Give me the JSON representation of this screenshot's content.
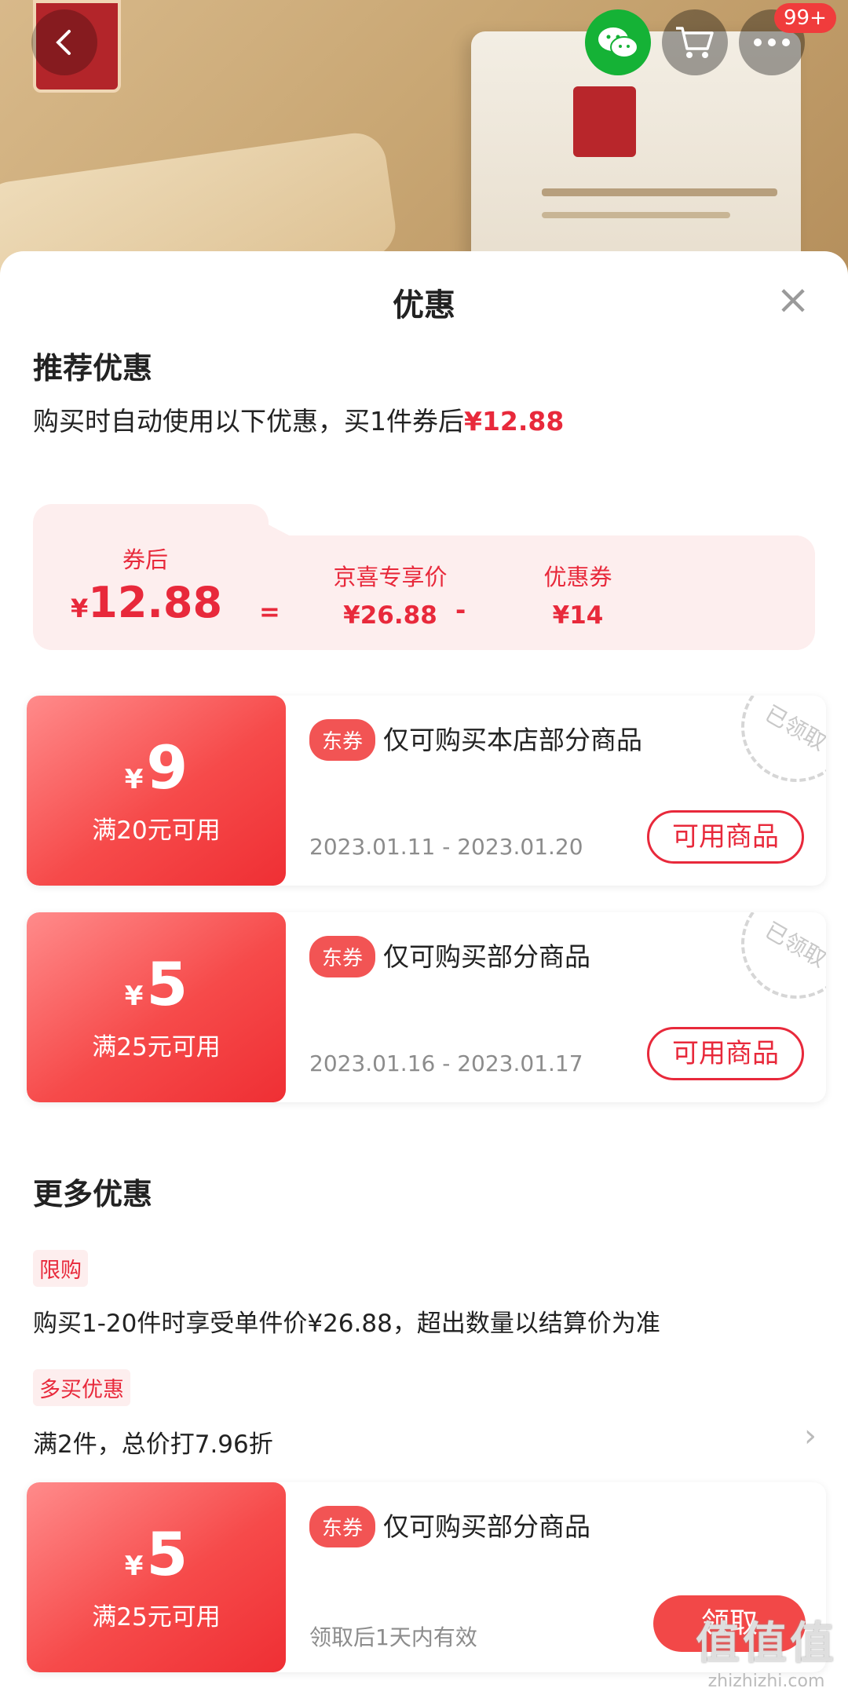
{
  "topbar": {
    "cart_badge": "99+"
  },
  "sheet": {
    "title": "优惠",
    "close_icon": "×"
  },
  "recommended": {
    "title": "推荐优惠",
    "desc_prefix": "购买时自动使用以下优惠，买1件券后",
    "desc_price": "¥12.88",
    "calc": {
      "after_label": "券后",
      "after_yen": "¥",
      "after_value": "12.88",
      "eq": "=",
      "jx_label": "京喜专享价",
      "jx_value": "¥26.88",
      "minus": "-",
      "coupon_label": "优惠券",
      "coupon_value": "¥14"
    }
  },
  "coupons": [
    {
      "yen": "¥",
      "amount": "9",
      "condition": "满20元可用",
      "tag": "东券",
      "title": "仅可购买本店部分商品",
      "date": "2023.01.11 - 2023.01.20",
      "button": "可用商品",
      "stamp": "已领取"
    },
    {
      "yen": "¥",
      "amount": "5",
      "condition": "满25元可用",
      "tag": "东券",
      "title": "仅可购买部分商品",
      "date": "2023.01.16 - 2023.01.17",
      "button": "可用商品",
      "stamp": "已领取"
    },
    {
      "yen": "¥",
      "amount": "5",
      "condition": "满25元可用",
      "tag": "东券",
      "title": "仅可购买部分商品",
      "date": "领取后1天内有效",
      "button": "领取"
    }
  ],
  "more": {
    "title": "更多优惠",
    "limit_tag": "限购",
    "limit_desc": "购买1-20件时享受单件价¥26.88，超出数量以结算价为准",
    "multi_tag": "多买优惠",
    "multi_desc": "满2件，总价打7.96折",
    "chevron": "›"
  },
  "watermark": {
    "line1": "值值值",
    "line2": "zhizhizhi.com"
  },
  "colors": {
    "accent": "#e8293b",
    "coupon_gradient_start": "#ff8b8b",
    "coupon_gradient_end": "#ef2f34",
    "calc_bg": "#fdeeee"
  }
}
